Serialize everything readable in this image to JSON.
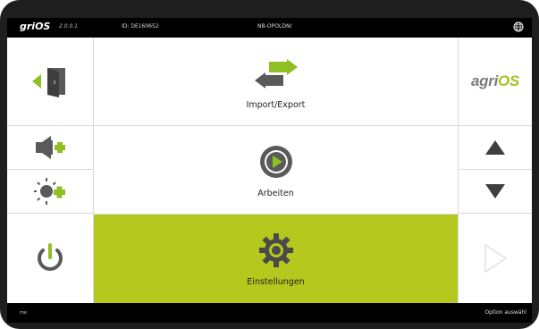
{
  "statusbar": {
    "logo": "griOS",
    "version": "2.0.0.1",
    "device_id": "ID: DE160652",
    "location": "NB-OPOLDNI"
  },
  "brand": {
    "prefix": "agri",
    "suffix": "OS"
  },
  "menu": {
    "items": [
      {
        "label": "Import/Export",
        "icon": "swap-arrows-icon"
      },
      {
        "label": "Arbeiten",
        "icon": "play-icon"
      },
      {
        "label": "Einstellungen",
        "icon": "gear-icon",
        "active": true
      }
    ]
  },
  "left_sidebar": {
    "icons": [
      "exit-door-icon",
      "volume-plus-icon",
      "brightness-plus-icon",
      "power-icon"
    ]
  },
  "right_sidebar": {
    "icons": [
      "arrow-up-icon",
      "arrow-down-icon",
      "next-arrow-icon"
    ]
  },
  "footer": {
    "left_text": "me",
    "right_text": "Option auswähl"
  },
  "colors": {
    "accent_green": "#b5c81d",
    "icon_green": "#8fbf22",
    "icon_gray": "#5a5a5a",
    "disabled_gray": "#e2e2e2"
  }
}
